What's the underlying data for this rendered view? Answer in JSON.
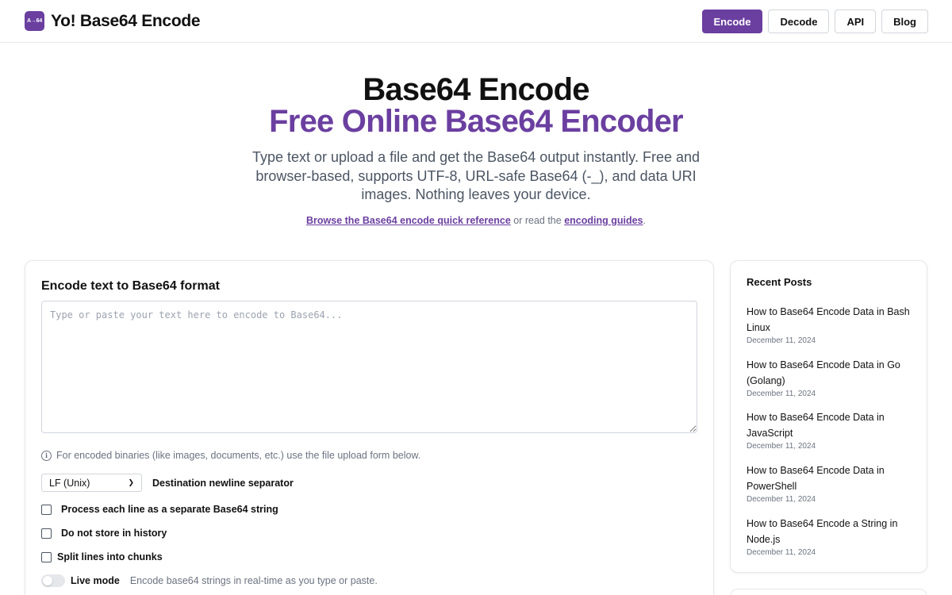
{
  "header": {
    "logo_text": "A→64",
    "title": "Yo! Base64 Encode",
    "nav": [
      {
        "label": "Encode",
        "active": true
      },
      {
        "label": "Decode",
        "active": false
      },
      {
        "label": "API",
        "active": false
      },
      {
        "label": "Blog",
        "active": false
      }
    ]
  },
  "hero": {
    "title_line1": "Base64 Encode",
    "title_line2": "Free Online Base64 Encoder",
    "description": "Type text or upload a file and get the Base64 output instantly. Free and browser-based, supports UTF-8, URL-safe Base64 (-_), and data URI images. Nothing leaves your device.",
    "link1": "Browse the Base64 encode quick reference",
    "link_middle": " or read the ",
    "link2": "encoding guides",
    "link_end": "."
  },
  "encoder": {
    "title": "Encode text to Base64 format",
    "input_placeholder": "Type or paste your text here to encode to Base64...",
    "input_value": "",
    "info_text": "For encoded binaries (like images, documents, etc.) use the file upload form below.",
    "newline_select_value": "LF (Unix)",
    "newline_label": "Destination newline separator",
    "checkbox_each_line": "Process each line as a separate Base64 string",
    "checkbox_no_history": "Do not store in history",
    "checkbox_split_chunks": "Split lines into chunks",
    "live_mode_label": "Live mode",
    "live_mode_desc": "Encode base64 strings in real-time as you type or paste."
  },
  "sidebar": {
    "title": "Recent Posts",
    "posts": [
      {
        "title": "How to Base64 Encode Data in Bash Linux",
        "date": "December 11, 2024"
      },
      {
        "title": "How to Base64 Encode Data in Go (Golang)",
        "date": "December 11, 2024"
      },
      {
        "title": "How to Base64 Encode Data in JavaScript",
        "date": "December 11, 2024"
      },
      {
        "title": "How to Base64 Encode Data in PowerShell",
        "date": "December 11, 2024"
      },
      {
        "title": "How to Base64 Encode a String in Node.js",
        "date": "December 11, 2024"
      }
    ]
  },
  "colors": {
    "accent": "#6b3fa0",
    "text": "#111111",
    "muted": "#6b7280",
    "border": "#e5e7eb"
  }
}
